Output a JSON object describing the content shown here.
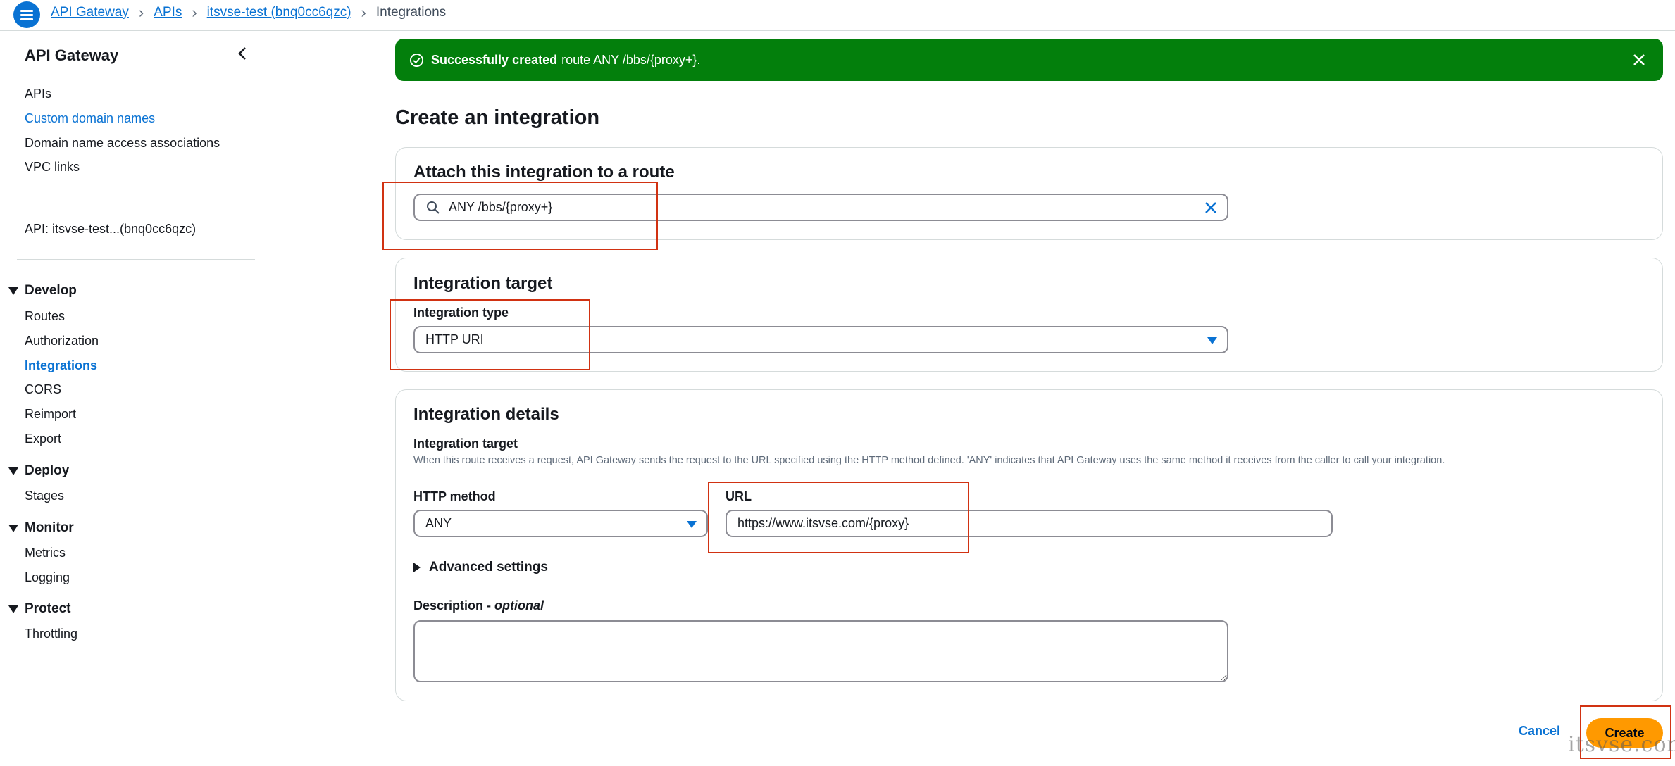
{
  "topbar": {
    "breadcrumbs": [
      {
        "label": "API Gateway"
      },
      {
        "label": "APIs"
      },
      {
        "label": "itsvse-test (bnq0cc6qzc)"
      },
      {
        "label": "Integrations"
      }
    ]
  },
  "sidebar": {
    "title": "API Gateway",
    "top_links": [
      "APIs",
      "Custom domain names",
      "Domain name access associations",
      "VPC links"
    ],
    "api_label": "API: itsvse-test...(bnq0cc6qzc)",
    "sections": [
      {
        "title": "Develop",
        "items": [
          "Routes",
          "Authorization",
          "Integrations",
          "CORS",
          "Reimport",
          "Export"
        ]
      },
      {
        "title": "Deploy",
        "items": [
          "Stages"
        ]
      },
      {
        "title": "Monitor",
        "items": [
          "Metrics",
          "Logging"
        ]
      },
      {
        "title": "Protect",
        "items": [
          "Throttling"
        ]
      }
    ]
  },
  "flash": {
    "bold": "Successfully created",
    "text": "route ANY /bbs/{proxy+}."
  },
  "page_title": "Create an integration",
  "attach_card": {
    "title": "Attach this integration to a route",
    "route_value": "ANY /bbs/{proxy+}"
  },
  "target_card": {
    "title": "Integration target",
    "type_label": "Integration type",
    "type_value": "HTTP URI"
  },
  "details_card": {
    "title": "Integration details",
    "sub_label": "Integration target",
    "sub_desc": "When this route receives a request, API Gateway sends the request to the URL specified using the HTTP method defined. 'ANY' indicates that API Gateway uses the same method it receives from the caller to call your integration.",
    "method_label": "HTTP method",
    "method_value": "ANY",
    "url_label": "URL",
    "url_value": "https://www.itsvse.com/{proxy}",
    "advanced_label": "Advanced settings",
    "description_label": "Description - ",
    "description_optional": "optional"
  },
  "actions": {
    "cancel": "Cancel",
    "create": "Create"
  },
  "watermark": "itsvse.com",
  "colors": {
    "accent": "#0972d3",
    "success": "#037f0c",
    "primary_button": "#ff9900",
    "highlight_box": "#d13212"
  }
}
